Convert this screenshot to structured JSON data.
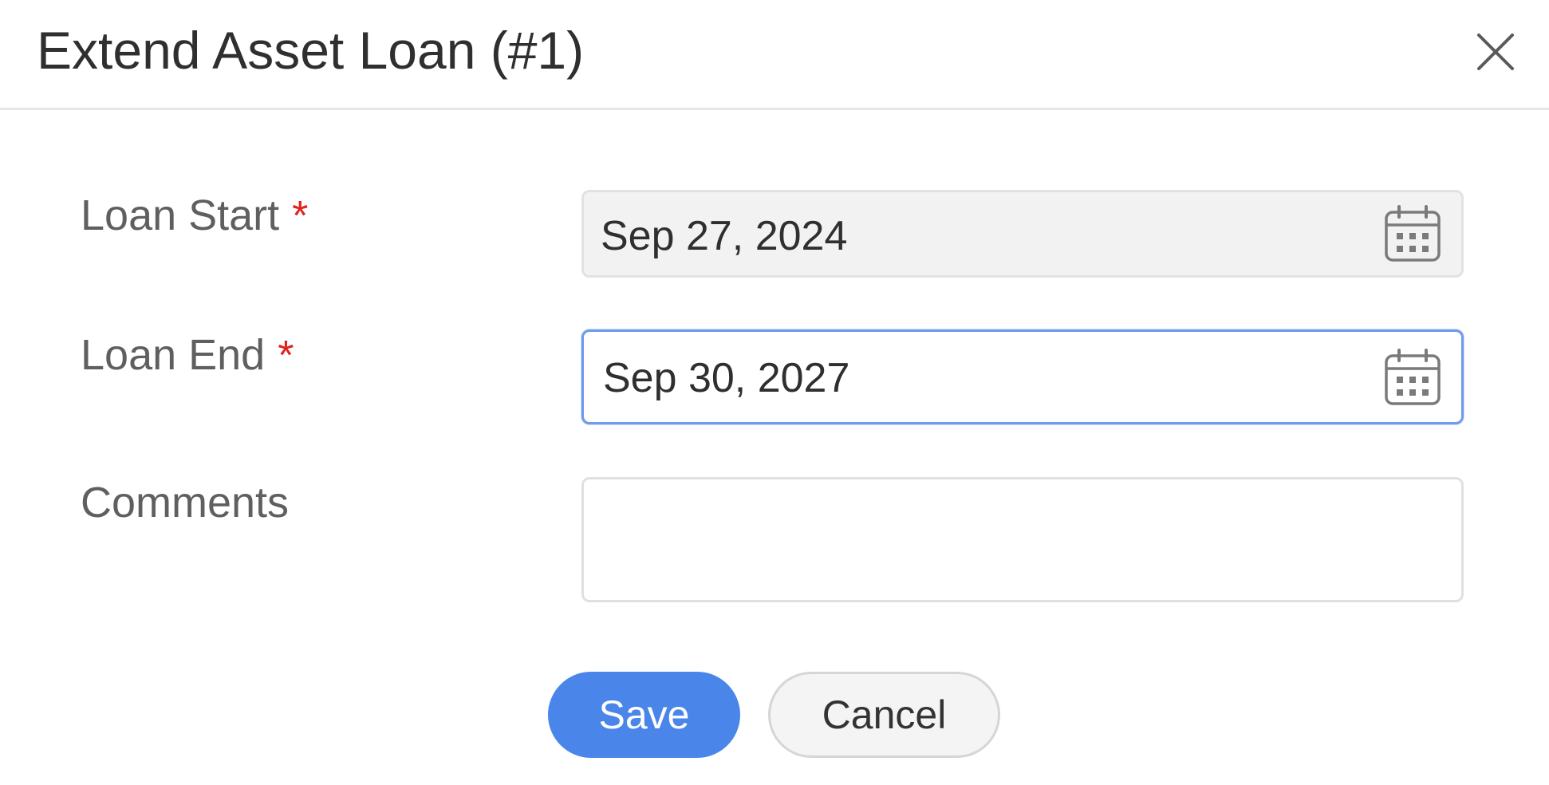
{
  "dialog": {
    "title": "Extend Asset Loan (#1)",
    "close_icon": "close-icon"
  },
  "form": {
    "loan_start": {
      "label": "Loan Start",
      "required_mark": "*",
      "value": "Sep 27, 2024",
      "icon": "calendar-icon"
    },
    "loan_end": {
      "label": "Loan End",
      "required_mark": "*",
      "value": "Sep 30, 2027",
      "icon": "calendar-icon"
    },
    "comments": {
      "label": "Comments",
      "value": "",
      "placeholder": ""
    }
  },
  "buttons": {
    "save_label": "Save",
    "cancel_label": "Cancel"
  },
  "colors": {
    "primary": "#4a86ea",
    "required": "#e0231e",
    "focus_border": "#6f9be8",
    "readonly_bg": "#f2f2f2"
  }
}
